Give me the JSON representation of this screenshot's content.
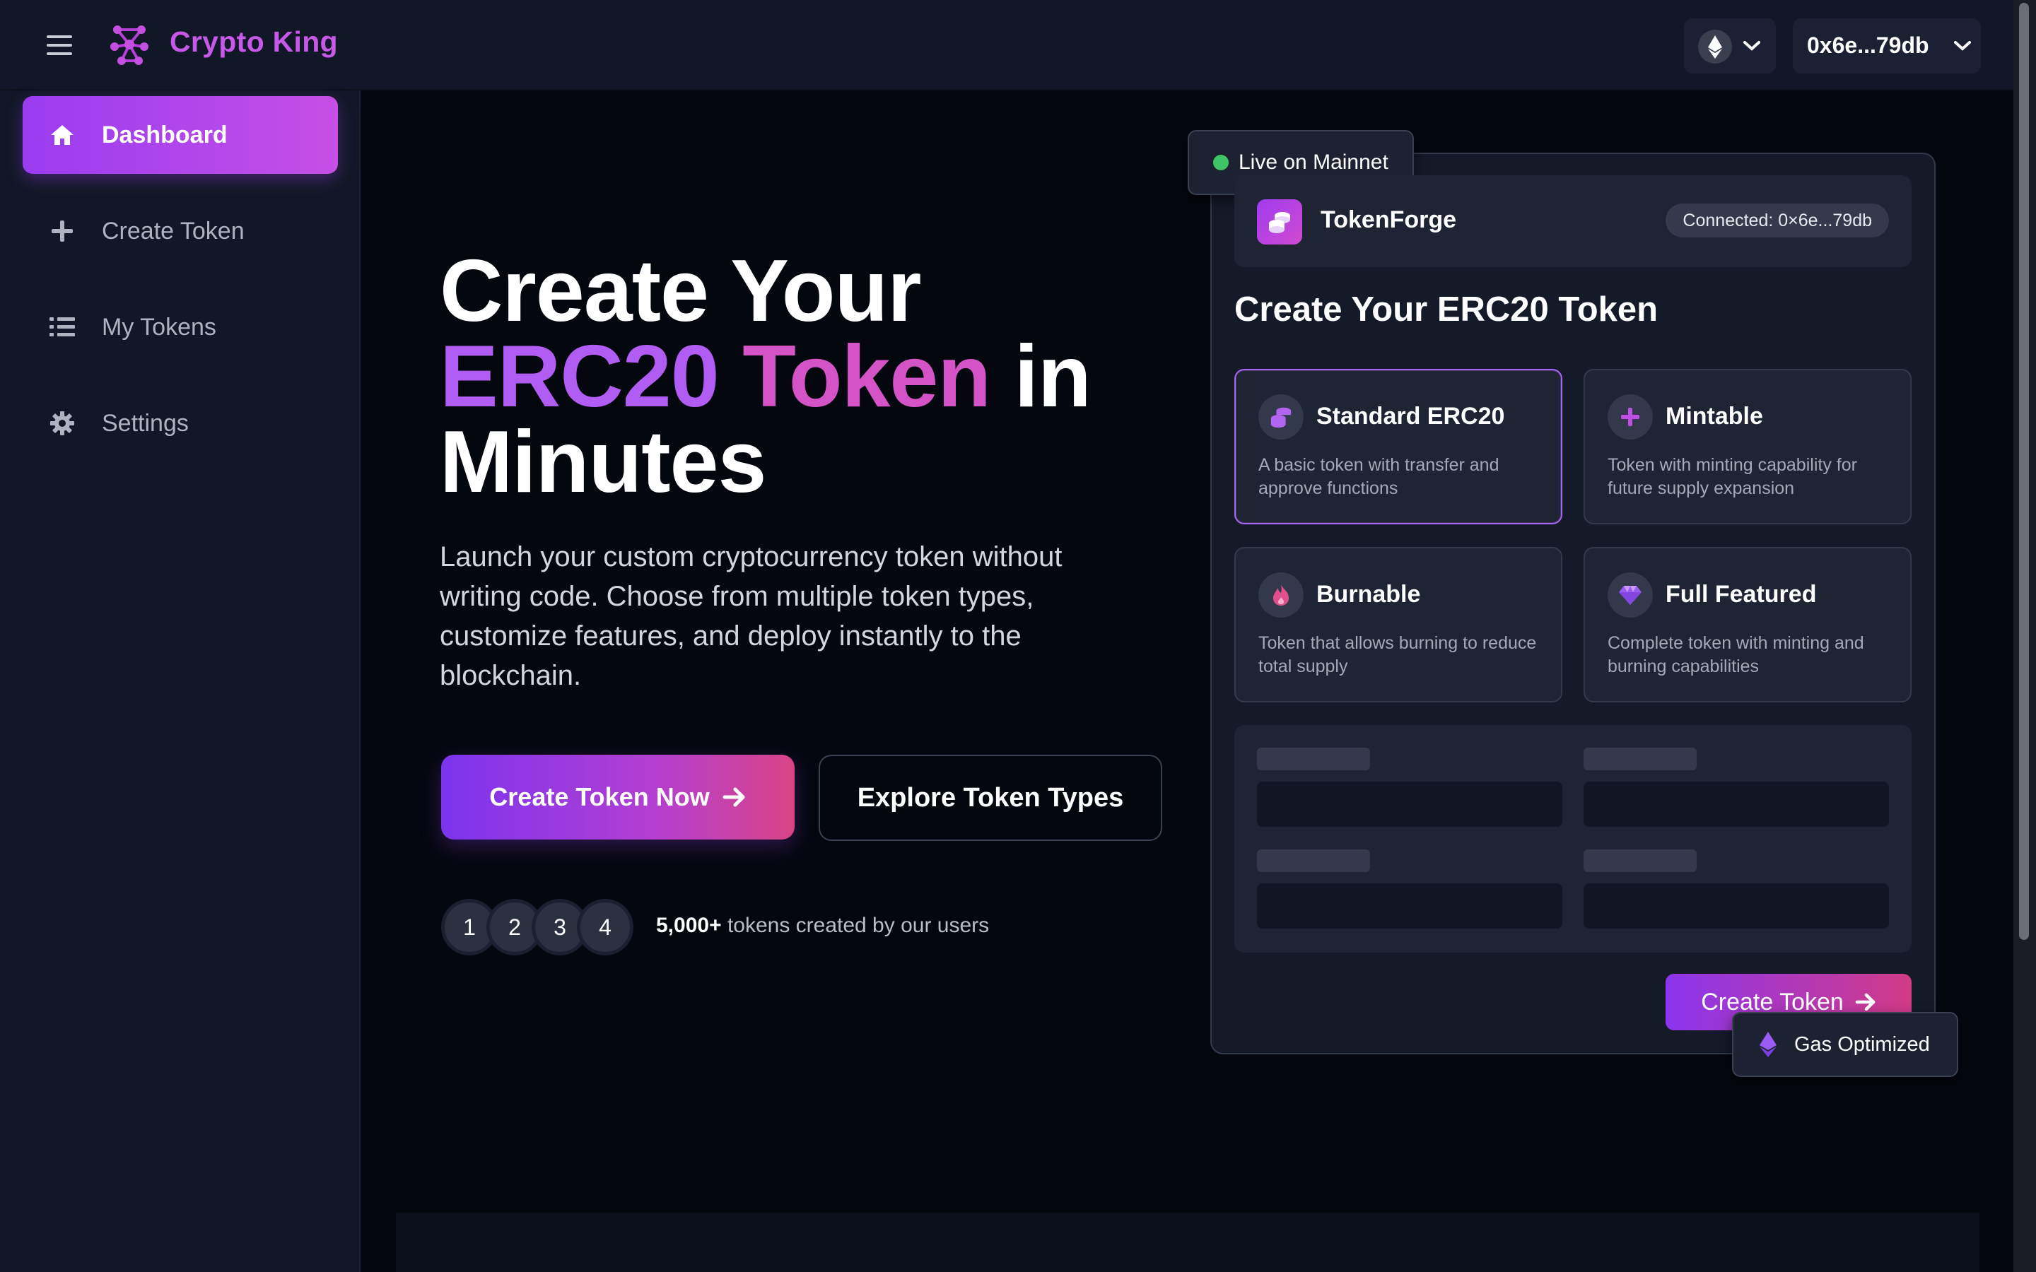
{
  "topbar": {
    "brand": "Crypto King",
    "network_icon": "ethereum-icon",
    "wallet_address": "0x6e...79db"
  },
  "sidebar": {
    "items": [
      {
        "label": "Dashboard",
        "icon": "home-icon",
        "active": true
      },
      {
        "label": "Create Token",
        "icon": "plus-icon",
        "active": false
      },
      {
        "label": "My Tokens",
        "icon": "list-icon",
        "active": false
      },
      {
        "label": "Settings",
        "icon": "gear-icon",
        "active": false
      }
    ]
  },
  "hero": {
    "title_line1": "Create Your",
    "title_erc": "ERC20",
    "title_token": "Token",
    "title_in": "in",
    "title_line3": "Minutes",
    "description": "Launch your custom cryptocurrency token without writing code. Choose from multiple token types, customize features, and deploy instantly to the blockchain.",
    "primary_button": "Create Token Now",
    "secondary_button": "Explore Token Types",
    "avatars": [
      "1",
      "2",
      "3",
      "4"
    ],
    "stat_number": "5,000+",
    "stat_text": "tokens created by our users"
  },
  "card": {
    "live_badge": "Live on Mainnet",
    "app_name": "TokenForge",
    "connected": "Connected: 0×6e...79db",
    "title": "Create Your ERC20 Token",
    "options": [
      {
        "name": "Standard ERC20",
        "desc": "A basic token with transfer and approve functions",
        "icon": "coins-icon",
        "selected": true
      },
      {
        "name": "Mintable",
        "desc": "Token with minting capability for future supply expansion",
        "icon": "plus-icon",
        "selected": false
      },
      {
        "name": "Burnable",
        "desc": "Token that allows burning to reduce total supply",
        "icon": "fire-icon",
        "selected": false
      },
      {
        "name": "Full Featured",
        "desc": "Complete token with minting and burning capabilities",
        "icon": "gem-icon",
        "selected": false
      }
    ],
    "create_button": "Create Token",
    "gas_badge": "Gas Optimized"
  },
  "colors": {
    "accent_purple": "#9a3cf0",
    "accent_pink": "#d94486",
    "brand": "#c759e8",
    "live_green": "#3fc466"
  }
}
